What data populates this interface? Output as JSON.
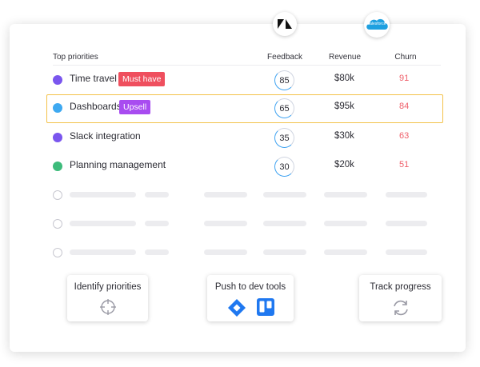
{
  "table": {
    "headers": {
      "priorities": "Top priorities",
      "feedback": "Feedback",
      "revenue": "Revenue",
      "churn": "Churn"
    },
    "rows": [
      {
        "name": "Time travel",
        "badge": "Must have",
        "badge_color": "#ef4f5e",
        "dot_color": "#7a56ee",
        "feedback": "85",
        "revenue": "$80k",
        "churn": "91"
      },
      {
        "name": "Dashboards",
        "badge": "Upsell",
        "badge_color": "#a84cf0",
        "dot_color": "#3ea9f1",
        "feedback": "65",
        "revenue": "$95k",
        "churn": "84"
      },
      {
        "name": "Slack integration",
        "badge": "",
        "dot_color": "#7a56ee",
        "feedback": "35",
        "revenue": "$30k",
        "churn": "63"
      },
      {
        "name": "Planning management",
        "badge": "",
        "dot_color": "#3dbb7b",
        "feedback": "30",
        "revenue": "$20k",
        "churn": "51"
      }
    ],
    "churn_color": "#ef5f6a"
  },
  "integrations": {
    "feedback_source": "zendesk-icon",
    "revenue_source": "salesforce-icon",
    "salesforce_label": "salesforce"
  },
  "workflow": {
    "steps": [
      {
        "title": "Identify priorities",
        "icon": "target-icon"
      },
      {
        "title": "Push to dev tools",
        "icons": [
          "jira-icon",
          "trello-icon"
        ]
      },
      {
        "title": "Track progress",
        "icon": "refresh-icon"
      }
    ],
    "connector_color": "#f0b23a"
  }
}
